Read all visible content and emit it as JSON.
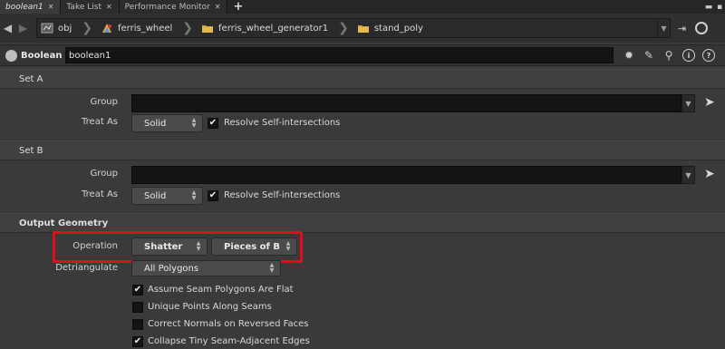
{
  "tabs": [
    {
      "label": "boolean1",
      "active": true
    },
    {
      "label": "Take List",
      "active": false
    },
    {
      "label": "Performance Monitor",
      "active": false
    }
  ],
  "path": {
    "crumbs": [
      "obj",
      "ferris_wheel",
      "ferris_wheel_generator1",
      "stand_poly"
    ]
  },
  "node": {
    "type_label": "Boolean",
    "name": "boolean1"
  },
  "set_a": {
    "title": "Set A",
    "group_label": "Group",
    "group_value": "",
    "treat_as_label": "Treat As",
    "treat_as_value": "Solid",
    "resolve_label": "Resolve Self-intersections",
    "resolve_checked": true
  },
  "set_b": {
    "title": "Set B",
    "group_label": "Group",
    "group_value": "",
    "treat_as_label": "Treat As",
    "treat_as_value": "Solid",
    "resolve_label": "Resolve Self-intersections",
    "resolve_checked": true
  },
  "output": {
    "title": "Output Geometry",
    "operation_label": "Operation",
    "operation_value": "Shatter",
    "operation_sub_value": "Pieces of B",
    "detriangulate_label": "Detriangulate",
    "detriangulate_value": "All Polygons",
    "options": [
      {
        "label": "Assume Seam Polygons Are Flat",
        "checked": true
      },
      {
        "label": "Unique Points Along Seams",
        "checked": false
      },
      {
        "label": "Correct Normals on Reversed Faces",
        "checked": false
      },
      {
        "label": "Collapse Tiny Seam-Adjacent Edges",
        "checked": true
      }
    ]
  },
  "colors": {
    "highlight": "#e00d1e",
    "panel_bg": "#3a3a3a",
    "field_bg": "#141414"
  },
  "icons": {
    "back": "back-arrow-icon",
    "forward": "forward-arrow-icon",
    "obj": "network-icon",
    "ferris_wheel": "geometry-object-icon",
    "folder": "subnet-folder-icon",
    "pin": "pin-icon",
    "help": "help-icon",
    "gear": "gear-icon",
    "brush": "brush-icon",
    "search": "magnifier-icon",
    "info": "info-icon",
    "question": "question-icon"
  }
}
